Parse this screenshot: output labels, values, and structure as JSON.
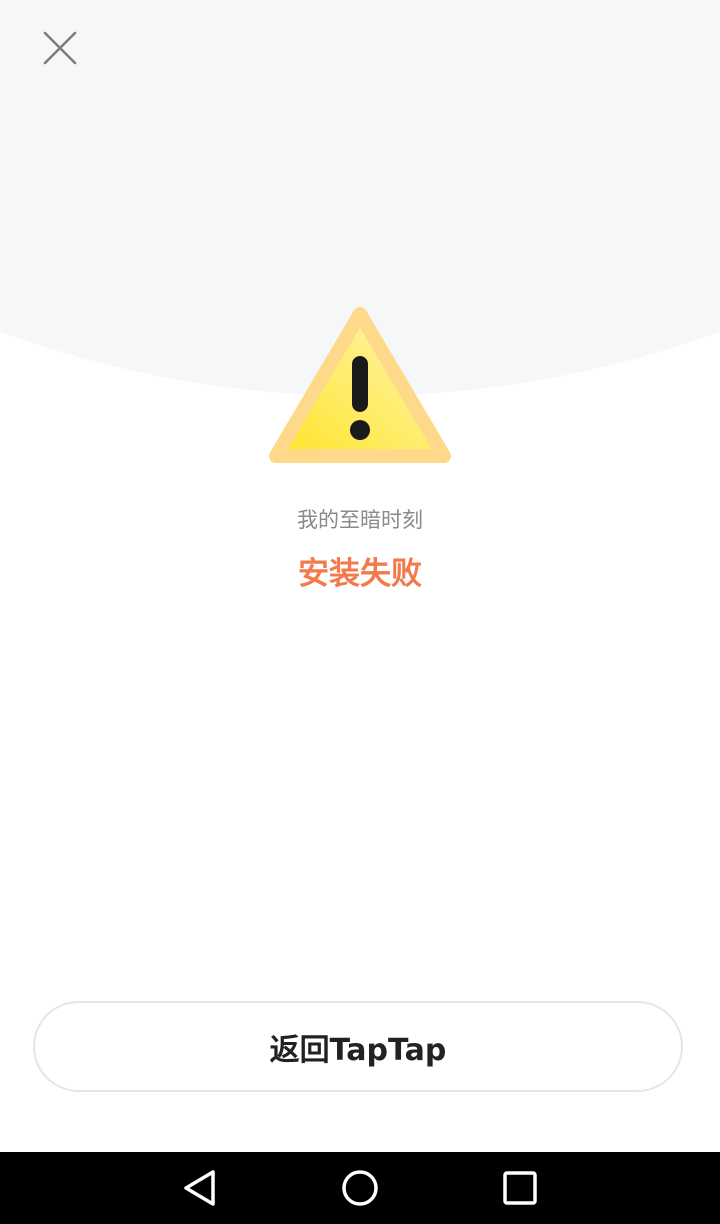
{
  "dialog": {
    "game_name": "我的至暗时刻",
    "status": "安装失败",
    "return_label": "返回TapTap"
  },
  "icons": {
    "close": "close-icon",
    "warning": "warning-icon",
    "nav_back": "nav-back-icon",
    "nav_home": "nav-home-icon",
    "nav_recents": "nav-recents-icon"
  },
  "colors": {
    "status": "#f27a4b",
    "top_background": "#f5f7f9",
    "warning_fill": "#ffe94a",
    "warning_border": "#ffd98a"
  }
}
